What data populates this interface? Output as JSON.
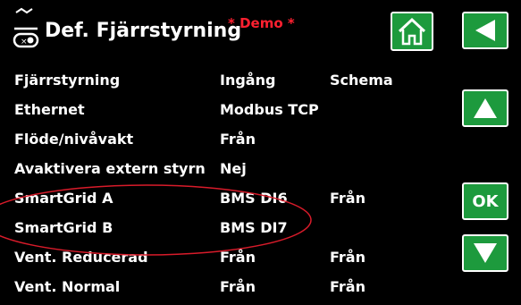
{
  "header": {
    "title": "Def. Fjärrstyrning",
    "demo_label": "* Demo *",
    "icon": "remote-switch-icon"
  },
  "buttons": {
    "home_icon": "home-icon",
    "back_icon": "back-arrow-icon",
    "up_icon": "up-arrow-icon",
    "ok_label": "OK",
    "down_icon": "down-arrow-icon"
  },
  "rows": [
    {
      "label": "Fjärrstyrning",
      "value": "Ingång",
      "extra": "Schema"
    },
    {
      "label": "Ethernet",
      "value": "Modbus TCP",
      "extra": ""
    },
    {
      "label": "Flöde/nivåvakt",
      "value": "Från",
      "extra": ""
    },
    {
      "label": "Avaktivera extern styrn",
      "value": "Nej",
      "extra": ""
    },
    {
      "label": "SmartGrid A",
      "value": "BMS DI6",
      "extra": "Från"
    },
    {
      "label": "SmartGrid B",
      "value": "BMS DI7",
      "extra": ""
    },
    {
      "label": "Vent. Reducerad",
      "value": "Från",
      "extra": "Från"
    },
    {
      "label": "Vent. Normal",
      "value": "Från",
      "extra": "Från"
    }
  ],
  "colors": {
    "button_green": "#1d9a3d",
    "demo_red": "#ff2030",
    "highlight_ellipse": "#d81b2a"
  }
}
